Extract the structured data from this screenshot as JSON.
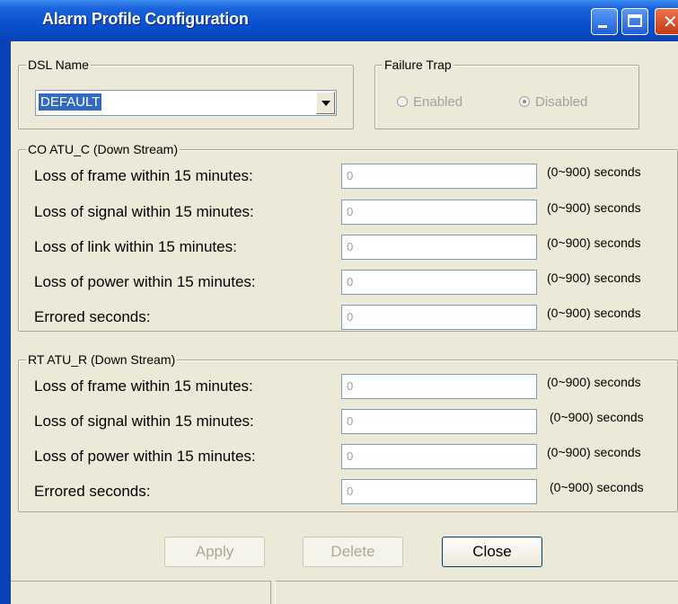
{
  "window": {
    "title": "Alarm Profile Configuration"
  },
  "dsl": {
    "legend": "DSL Name",
    "selected": "DEFAULT"
  },
  "failure_trap": {
    "legend": "Failure Trap",
    "enabled_label": "Enabled",
    "disabled_label": "Disabled",
    "selected": "Disabled"
  },
  "co": {
    "legend": "CO ATU_C (Down Stream)",
    "rows": [
      {
        "label": "Loss of frame within 15 minutes:",
        "value": "0",
        "unit": "(0~900) seconds"
      },
      {
        "label": "Loss of signal within 15 minutes:",
        "value": "0",
        "unit": "(0~900) seconds"
      },
      {
        "label": "Loss of link within 15 minutes:",
        "value": "0",
        "unit": "(0~900) seconds"
      },
      {
        "label": "Loss of power within 15 minutes:",
        "value": "0",
        "unit": "(0~900) seconds"
      },
      {
        "label": "Errored seconds:",
        "value": "0",
        "unit": "(0~900) seconds"
      }
    ]
  },
  "rt": {
    "legend": "RT ATU_R (Down Stream)",
    "rows": [
      {
        "label": "Loss of frame within 15 minutes:",
        "value": "0",
        "unit": "(0~900) seconds"
      },
      {
        "label": "Loss of signal within 15 minutes:",
        "value": "0",
        "unit": "(0~900) seconds"
      },
      {
        "label": "Loss of power within 15 minutes:",
        "value": "0",
        "unit": "(0~900) seconds"
      },
      {
        "label": "Errored seconds:",
        "value": "0",
        "unit": "(0~900) seconds"
      }
    ]
  },
  "buttons": {
    "apply": "Apply",
    "delete": "Delete",
    "close": "Close"
  }
}
